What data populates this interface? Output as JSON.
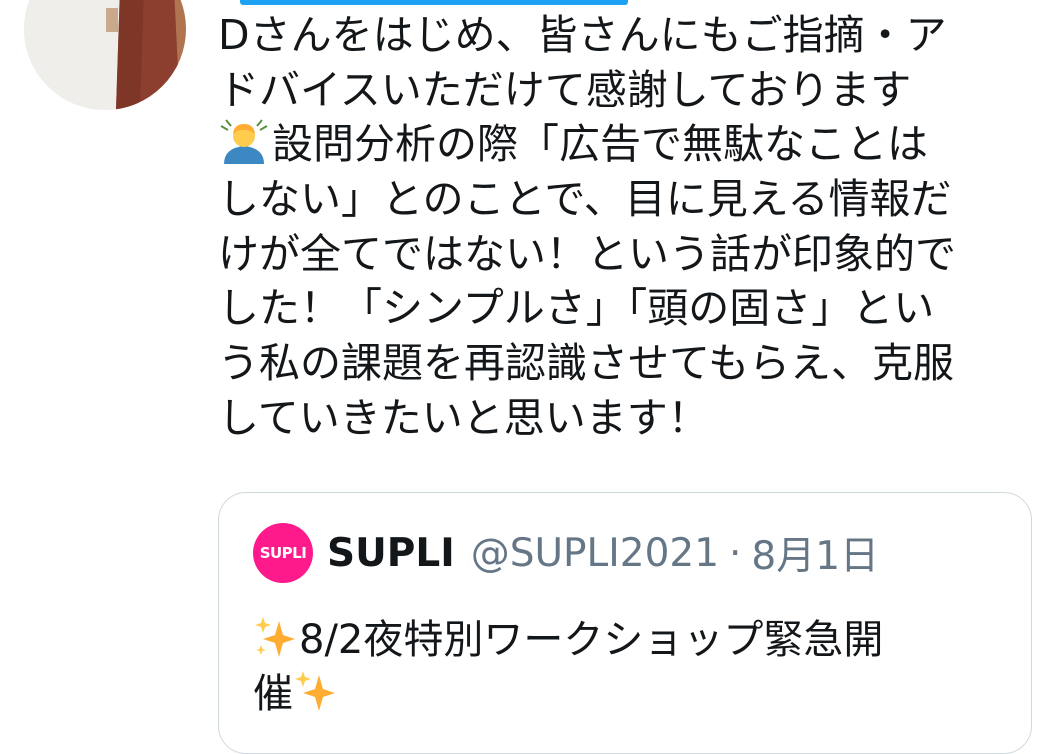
{
  "colors": {
    "accent": "#1da1f2",
    "text": "#14171a",
    "muted": "#657786",
    "border": "#cfd9de",
    "supli_brand": "#ff1a8c"
  },
  "tweet": {
    "lines": [
      "Dさんをはじめ、皆さんにもご指摘・ア",
      "ドバイスいただけて感謝しております",
      "設問分析の際「広告で無駄なことは",
      "しない」とのことで、目に見える情報だ",
      "けが全てではない！という話が印象的で",
      "した！「シンプルさ」「頭の固さ」とい",
      "う私の課題を再認識させてもらえ、克服",
      "していきたいと思います！"
    ],
    "emoji_icon": "person-bowing-emoji-icon"
  },
  "quote": {
    "avatar_text": "SUPLI",
    "name": "SUPLI",
    "handle": "@SUPLI2021",
    "separator": "·",
    "date": "8月1日",
    "body_lines": [
      "8/2夜特別ワークショップ緊急開",
      "催"
    ],
    "sparkle_icon": "sparkles-emoji-icon"
  }
}
